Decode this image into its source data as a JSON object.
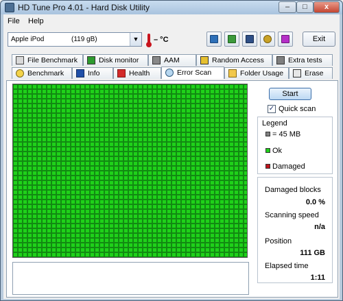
{
  "window": {
    "title": "HD Tune Pro 4.01 - Hard Disk Utility",
    "minimize_glyph": "–",
    "maximize_glyph": "□",
    "close_glyph": "x"
  },
  "menu": {
    "items": [
      "File",
      "Help"
    ]
  },
  "toolbar": {
    "drive_name": "Apple   iPod",
    "drive_size": "(119 gB)",
    "temperature": "– °C",
    "exit_label": "Exit",
    "icons": [
      "copy-text-icon",
      "copy-screenshot-icon",
      "save-icon",
      "options-icon",
      "download-icon"
    ]
  },
  "tabs": {
    "row1": [
      {
        "label": "File Benchmark",
        "icon": "file-benchmark-icon"
      },
      {
        "label": "Disk monitor",
        "icon": "disk-monitor-icon"
      },
      {
        "label": "AAM",
        "icon": "speaker-icon"
      },
      {
        "label": "Random Access",
        "icon": "random-access-icon"
      },
      {
        "label": "Extra tests",
        "icon": "extra-tests-icon"
      }
    ],
    "row2": [
      {
        "label": "Benchmark",
        "icon": "lightbulb-icon"
      },
      {
        "label": "Info",
        "icon": "info-icon"
      },
      {
        "label": "Health",
        "icon": "health-cross-icon"
      },
      {
        "label": "Error Scan",
        "icon": "magnifier-icon",
        "active": true
      },
      {
        "label": "Folder Usage",
        "icon": "folder-icon"
      },
      {
        "label": "Erase",
        "icon": "erase-icon"
      }
    ]
  },
  "scan": {
    "start_label": "Start",
    "quick_scan_label": "Quick scan",
    "quick_scan_checked": true,
    "legend_title": "Legend",
    "legend": [
      {
        "label": "= 45 MB",
        "color": "#808080"
      },
      {
        "label": "Ok",
        "color": "#1fd11a"
      },
      {
        "label": "Damaged",
        "color": "#c0141b"
      }
    ],
    "stats": [
      {
        "label": "Damaged blocks",
        "value": "0.0 %"
      },
      {
        "label": "Scanning speed",
        "value": "n/a"
      },
      {
        "label": "Position",
        "value": "111 GB"
      },
      {
        "label": "Elapsed time",
        "value": "1:11"
      }
    ],
    "colors": {
      "ok": "#1fd11a",
      "damaged": "#c0141b",
      "grid_border": "#128a12"
    }
  }
}
